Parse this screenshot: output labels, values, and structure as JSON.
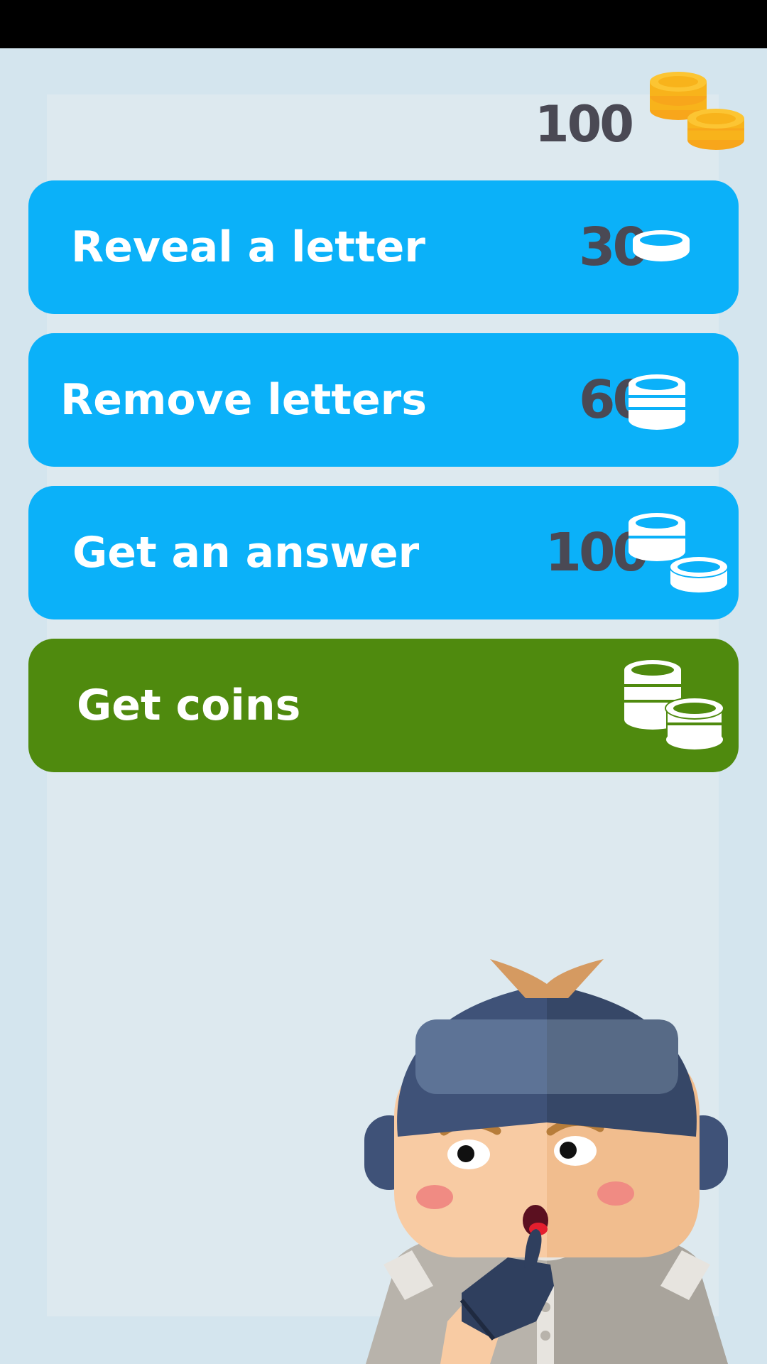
{
  "header": {
    "coin_balance": "100",
    "coin_icon": "gold-coin-stack-icon"
  },
  "hints": [
    {
      "label": "Reveal a letter",
      "price": "30",
      "icon": "single-coin-icon"
    },
    {
      "label": "Remove letters",
      "price": "60",
      "icon": "coin-stack-icon"
    },
    {
      "label": "Get an answer",
      "price": "100",
      "icon": "coin-stacks-icon"
    }
  ],
  "get_coins": {
    "label": "Get coins",
    "icon": "coin-stacks-icon"
  },
  "colors": {
    "hint_button": "#0bb1f9",
    "get_coins_button": "#4f8a0e",
    "price_text": "#4a4954",
    "background": "#d4e5ee",
    "gold": "#f8b31b"
  },
  "mascot": "thinking-boy-character"
}
